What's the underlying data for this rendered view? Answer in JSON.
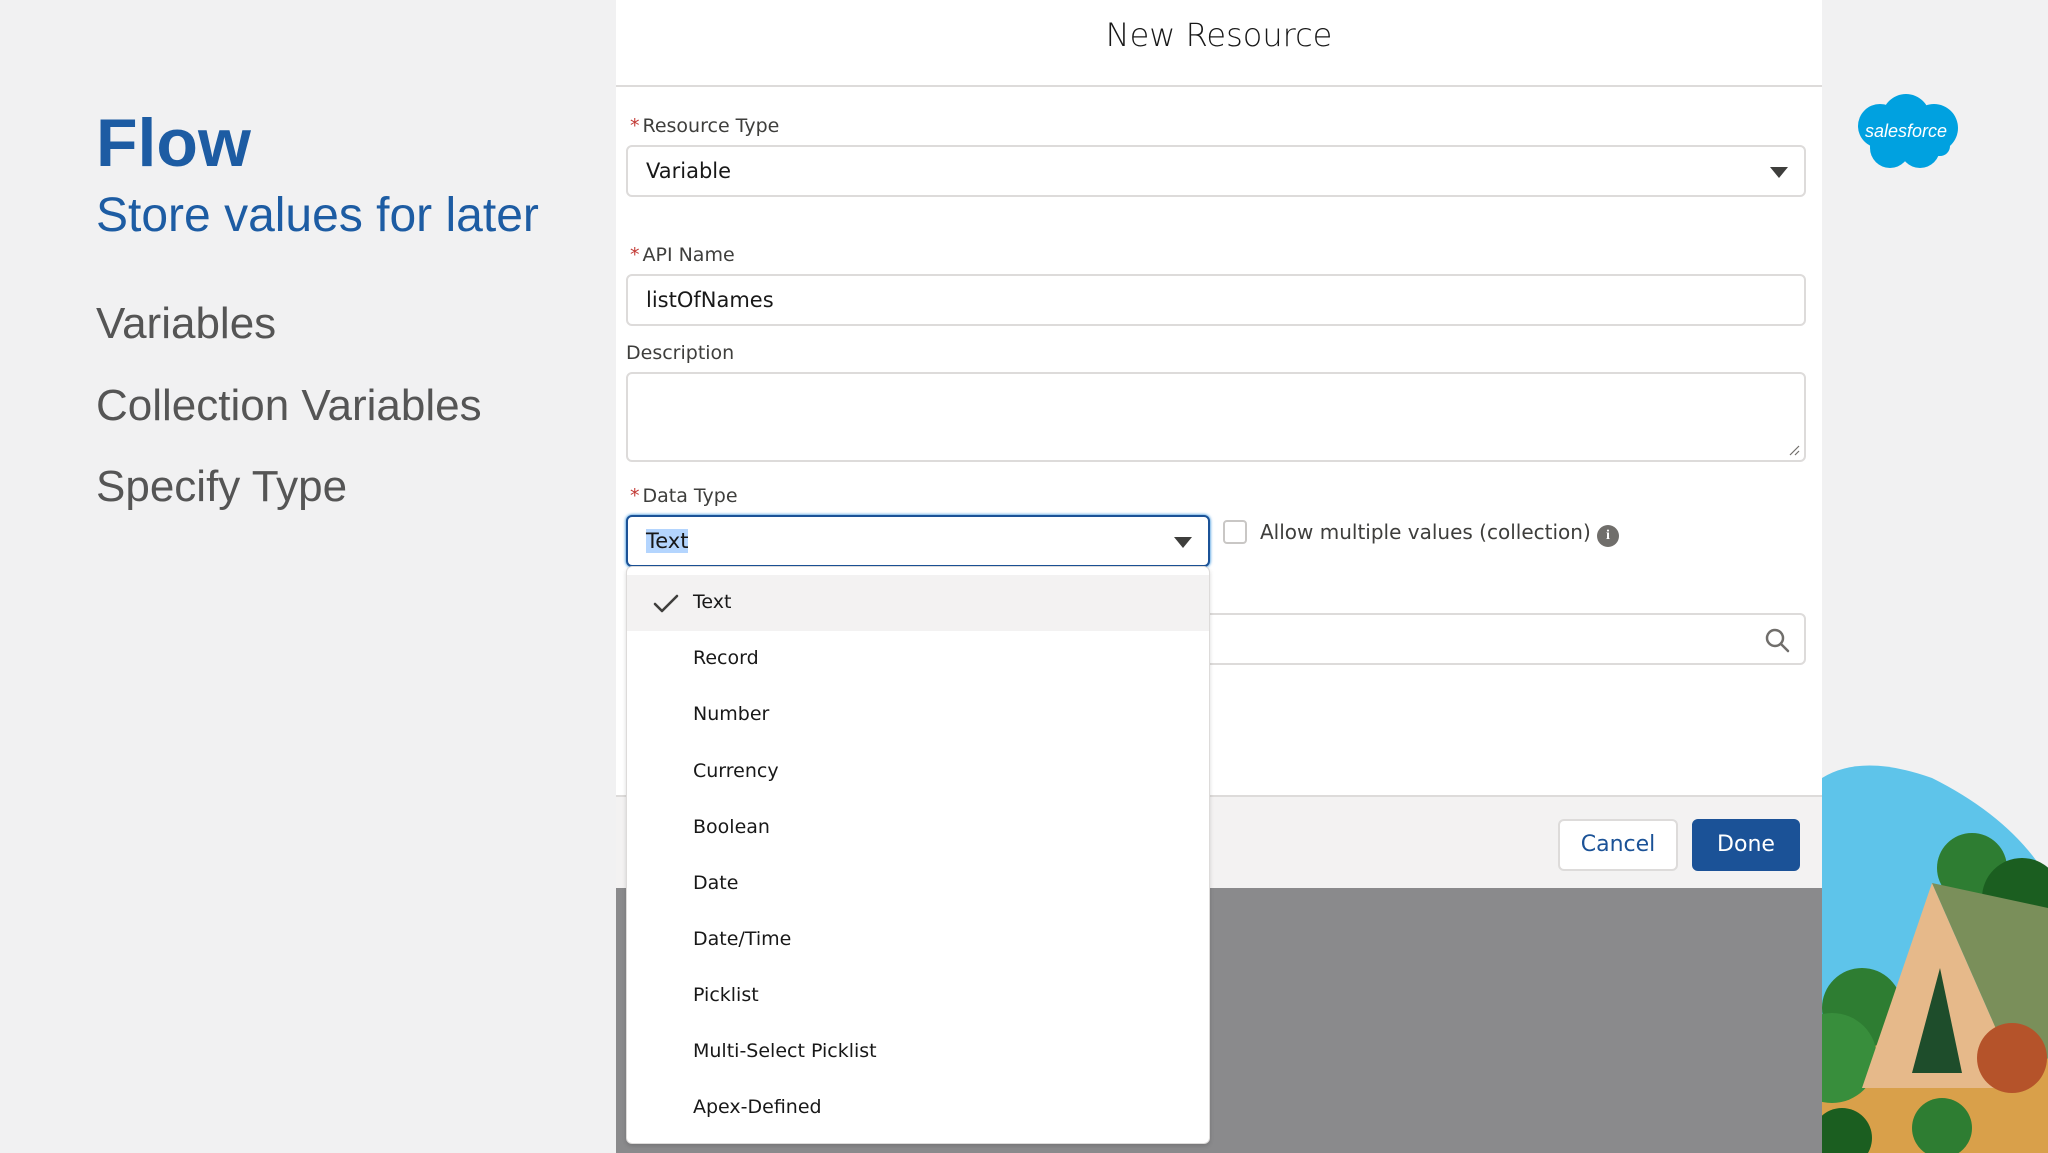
{
  "slide": {
    "title": "Flow",
    "subtitle": "Store values for later",
    "bullets": [
      "Variables",
      "Collection Variables",
      "Specify Type"
    ]
  },
  "logo": {
    "text": "salesforce"
  },
  "modal": {
    "title": "New Resource",
    "resource_type": {
      "label": "Resource Type",
      "value": "Variable"
    },
    "api_name": {
      "label": "API Name",
      "value": "listOfNames"
    },
    "description": {
      "label": "Description",
      "value": ""
    },
    "data_type": {
      "label": "Data Type",
      "value": "Text"
    },
    "allow_multiple": {
      "label": "Allow multiple values (collection)",
      "checked": false
    },
    "cancel_label": "Cancel",
    "done_label": "Done"
  },
  "dropdown": {
    "selected": "Text",
    "options": [
      "Text",
      "Record",
      "Number",
      "Currency",
      "Boolean",
      "Date",
      "Date/Time",
      "Picklist",
      "Multi-Select Picklist",
      "Apex-Defined"
    ]
  },
  "colors": {
    "brand_blue": "#1d5ca3",
    "button_blue": "#1b5297",
    "required_red": "#c23934",
    "logo_blue": "#00a1e0"
  }
}
